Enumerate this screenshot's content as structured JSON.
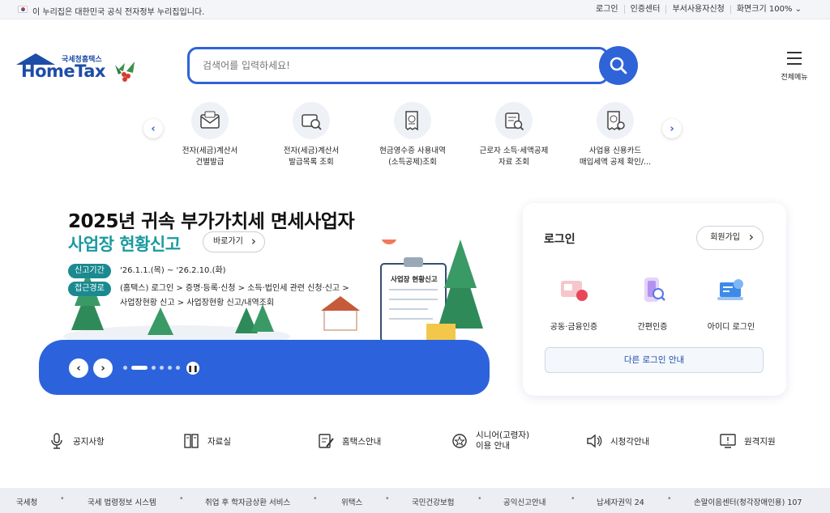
{
  "topbar": {
    "notice": "이 누리집은 대한민국 공식 전자정부 누리집입니다.",
    "links": [
      "로그인",
      "인증센터",
      "부서사용자신청",
      "화면크기 100% ⌄"
    ]
  },
  "logo": {
    "sub": "국세청홈택스",
    "main": "HomeTax"
  },
  "search": {
    "placeholder": "검색어를 입력하세요!"
  },
  "menu": {
    "label": "전체메뉴"
  },
  "quick_menu": [
    {
      "label": "전자(세금)계산서 건별발급",
      "line1": "전자(세금)계산서",
      "line2": "건별발급"
    },
    {
      "label": "전자(세금)계산서 발급목록 조회",
      "line1": "전자(세금)계산서",
      "line2": "발급목록 조회"
    },
    {
      "label": "현금영수증 사용내역(소득공제)조회",
      "line1": "현금영수증 사용내역",
      "line2": "(소득공제)조회"
    },
    {
      "label": "근로자 소득·세액공제 자료 조회",
      "line1": "근로자 소득·세액공제",
      "line2": "자료 조회"
    },
    {
      "label": "사업용 신용카드 매입세액 공제 확인/...",
      "line1": "사업용 신용카드",
      "line2": "매입세액 공제 확인/..."
    }
  ],
  "hero": {
    "title1": "2025년 귀속 부가가치세 면세사업자",
    "title2": "사업장 현황신고",
    "go_label": "바로가기",
    "tag1": "신고기간",
    "period": "'26.1.1.(목) ~ '26.2.10.(화)",
    "tag2": "접근경로",
    "path1": "(홈택스) 로그인 > 증명·등록·신청 > 소득·법인세 관련 신청·신고 >",
    "path2": "사업장현황 신고 > 사업장현황 신고/내역조회",
    "board_title": "사업장 현황신고",
    "slide_current": 2,
    "slide_total": 6
  },
  "login": {
    "title": "로그인",
    "join_label": "회원가입",
    "options": [
      "공동·금융인증",
      "간편인증",
      "아이디 로그인"
    ],
    "other_label": "다른 로그인 안내"
  },
  "services": [
    {
      "label": "공지사항"
    },
    {
      "label": "자료실"
    },
    {
      "label": "홈택스안내"
    },
    {
      "label": "시니어(고령자) 이용 안내",
      "line1": "시니어(고령자)",
      "line2": "이용 안내"
    },
    {
      "label": "시청각안내"
    },
    {
      "label": "원격지원"
    }
  ],
  "footer": [
    "국세청",
    "국세 법령정보 시스템",
    "취업 후 학자금상환 서비스",
    "위택스",
    "국민건강보험",
    "공익신고안내",
    "납세자권익 24",
    "손말이음센터(청각장애인용) 107"
  ],
  "colors": {
    "brand": "#1e4da7",
    "accent": "#2f63d8",
    "teal": "#1a9aa0"
  }
}
